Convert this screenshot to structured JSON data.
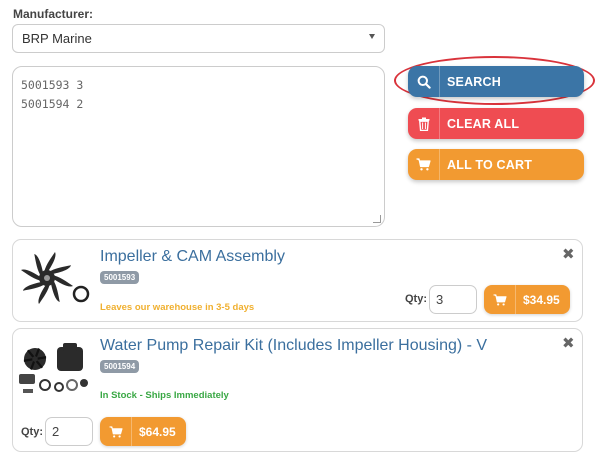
{
  "manufacturer": {
    "label": "Manufacturer:",
    "selected": "BRP Marine"
  },
  "part_input": {
    "lines": [
      "5001593 3",
      "5001594 2"
    ]
  },
  "actions": {
    "search_label": "SEARCH",
    "clear_label": "CLEAR ALL",
    "cart_label": "ALL TO CART"
  },
  "results": [
    {
      "title": "Impeller & CAM Assembly",
      "sku": "5001593",
      "status": "Leaves our warehouse in 3-5 days",
      "status_color": "#f0b030",
      "qty_label": "Qty:",
      "qty": "3",
      "price": "$34.95"
    },
    {
      "title": "Water Pump Repair Kit (Includes Impeller Housing) - V",
      "sku": "5001594",
      "status": "In Stock - Ships Immediately",
      "status_color": "#3aa845",
      "qty_label": "Qty:",
      "qty": "2",
      "price": "$64.95"
    }
  ],
  "colors": {
    "search": "#3b75a6",
    "clear": "#ef4c52",
    "cart": "#f29a31",
    "title_link": "#3b6f9e",
    "highlight": "#d9333b"
  },
  "icons": {
    "search": "search-icon",
    "clear": "trash-icon",
    "cart": "cart-icon",
    "remove": "close-icon"
  }
}
